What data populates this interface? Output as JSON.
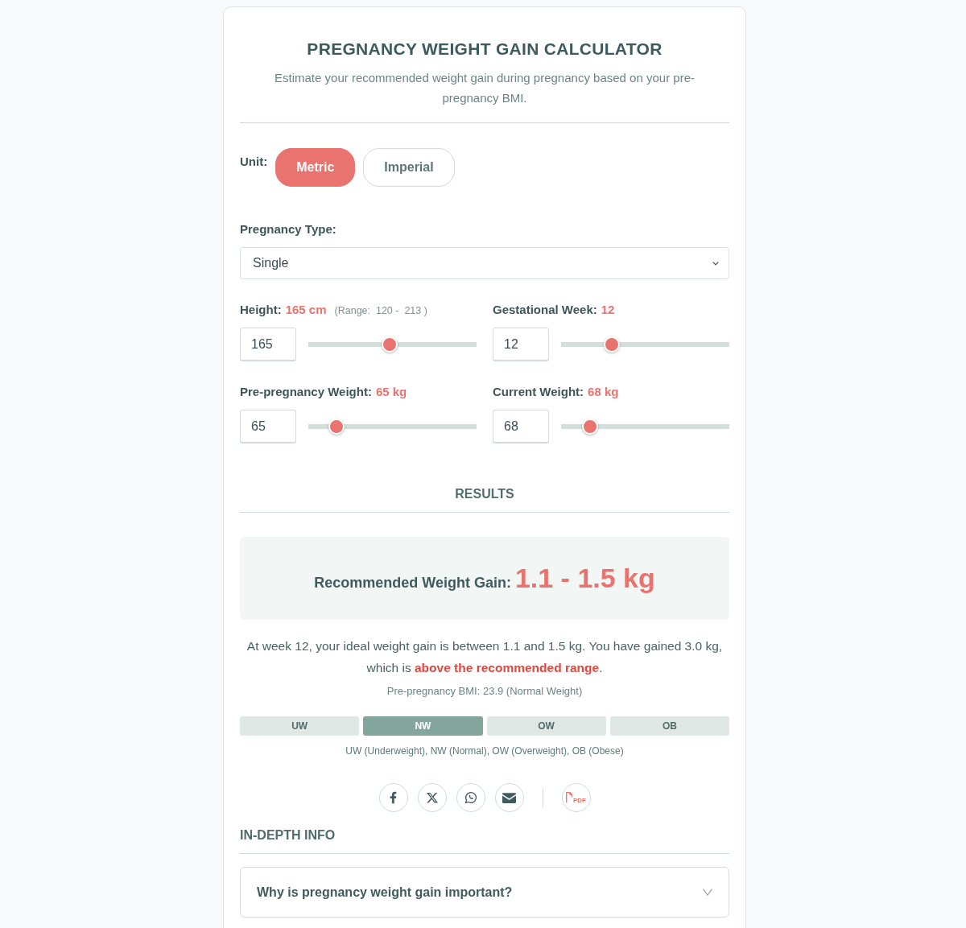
{
  "header": {
    "title": "PREGNANCY WEIGHT GAIN CALCULATOR",
    "subtitle": "Estimate your recommended weight gain during pregnancy based on your pre-pregnancy BMI."
  },
  "unit": {
    "label": "Unit:",
    "options": [
      {
        "label": "Metric",
        "selected": true
      },
      {
        "label": "Imperial",
        "selected": false
      }
    ]
  },
  "pregnancy_type": {
    "label": "Pregnancy Type:",
    "value": "Single"
  },
  "inputs": [
    {
      "label": "Height:",
      "reading": "165 cm",
      "range_note": "(Range:  120 -  213 )",
      "value": "165",
      "level": 0.48
    },
    {
      "label": "Gestational Week:",
      "reading": "12",
      "value": "12",
      "level": 0.28
    },
    {
      "label": "Pre-pregnancy Weight:",
      "reading": "65 kg",
      "value": "65",
      "level": 0.13
    },
    {
      "label": "Current Weight:",
      "reading": "68 kg",
      "value": "68",
      "level": 0.14
    }
  ],
  "results": {
    "heading": "RESULTS",
    "gain_label": "Recommended Weight Gain:",
    "gain_value": "1.1 - 1.5 kg",
    "summary": "At week 12, your ideal weight gain is between 1.1 and 1.5 kg. You have gained 3.0 kg, which is **above the recommended range**.",
    "bmi_note": "Pre-pregnancy BMI: 23.9 (Normal Weight)",
    "bmi_categories": [
      {
        "label": "UW",
        "selected": false
      },
      {
        "label": "NW",
        "selected": true
      },
      {
        "label": "OW",
        "selected": false
      },
      {
        "label": "OB",
        "selected": false
      }
    ],
    "legend": "UW (Underweight), NW (Normal), OW (Overweight), OB (Obese)"
  },
  "share": {
    "pdf_label": "PDF"
  },
  "in_depth": {
    "heading": "IN-DEPTH INFO",
    "items": [
      {
        "question": "Why is pregnancy weight gain important?",
        "expanded": false
      }
    ]
  }
}
